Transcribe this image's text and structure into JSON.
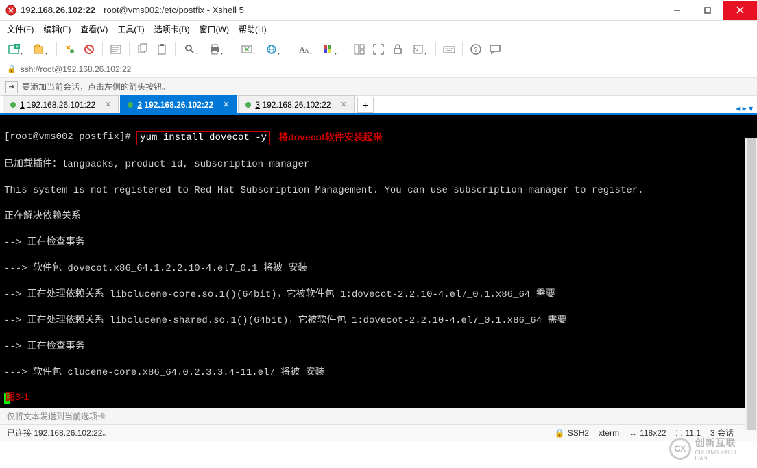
{
  "titlebar": {
    "host": "192.168.26.102:22",
    "path": "root@vms002:/etc/postfix - Xshell 5"
  },
  "menu": {
    "file": "文件(F)",
    "edit": "编辑(E)",
    "view": "查看(V)",
    "tools": "工具(T)",
    "tabs": "选项卡(B)",
    "window": "窗口(W)",
    "help": "帮助(H)"
  },
  "address": {
    "url": "ssh://root@192.168.26.102:22"
  },
  "hint": {
    "text": "要添加当前会话，点击左侧的箭头按钮。"
  },
  "tabs": [
    {
      "index": "1",
      "label": "192.168.26.101:22",
      "active": false
    },
    {
      "index": "2",
      "label": "192.168.26.102:22",
      "active": true
    },
    {
      "index": "3",
      "label": "192.168.26.102:22",
      "active": false
    }
  ],
  "terminal": {
    "prompt": "[root@vms002 postfix]# ",
    "command": "yum install dovecot -y",
    "annotation": "将dovecot软件安装起来",
    "lines": [
      "已加载插件：langpacks, product-id, subscription-manager",
      "This system is not registered to Red Hat Subscription Management. You can use subscription-manager to register.",
      "正在解决依赖关系",
      "--> 正在检查事务",
      "---> 软件包 dovecot.x86_64.1.2.2.10-4.el7_0.1 将被 安装",
      "--> 正在处理依赖关系 libclucene-core.so.1()(64bit)，它被软件包 1:dovecot-2.2.10-4.el7_0.1.x86_64 需要",
      "--> 正在处理依赖关系 libclucene-shared.so.1()(64bit)，它被软件包 1:dovecot-2.2.10-4.el7_0.1.x86_64 需要",
      "--> 正在检查事务",
      "---> 软件包 clucene-core.x86_64.0.2.3.3.4-11.el7 将被 安装"
    ],
    "figure_label": "图3-1"
  },
  "inputbar": {
    "placeholder": "仅将文本发送到当前选项卡"
  },
  "status": {
    "connection": "已连接 192.168.26.102:22。",
    "protocol": "SSH2",
    "term": "xterm",
    "size": "118x22",
    "cursor": "11,1",
    "sessions": "3 会话"
  },
  "watermark": {
    "main": "创新互联",
    "sub": "CHUANG XIN HU LIAN"
  }
}
